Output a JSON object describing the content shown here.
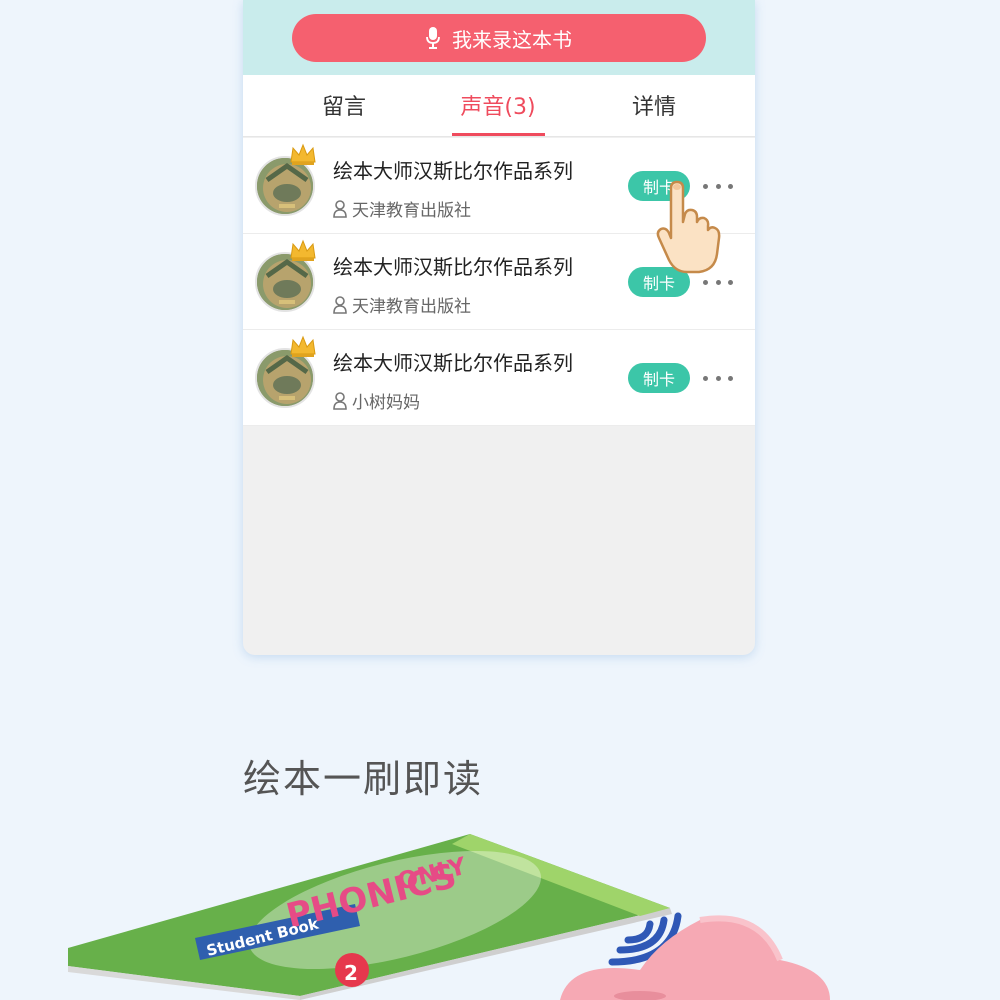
{
  "record_button": {
    "label": "我来录这本书"
  },
  "tabs": [
    {
      "label": "留言",
      "active": false
    },
    {
      "label": "声音(3)",
      "active": true
    },
    {
      "label": "详情",
      "active": false
    }
  ],
  "items": [
    {
      "title": "绘本大师汉斯比尔作品系列",
      "author": "天津教育出版社",
      "action": "制卡"
    },
    {
      "title": "绘本大师汉斯比尔作品系列",
      "author": "天津教育出版社",
      "action": "制卡"
    },
    {
      "title": "绘本大师汉斯比尔作品系列",
      "author": "小树妈妈",
      "action": "制卡"
    }
  ],
  "section": {
    "title": "绘本一刷即读"
  },
  "book": {
    "cover_text_1": "ONLY",
    "cover_text_2": "PHONICS",
    "cover_text_3": "Student Book",
    "volume": "2"
  },
  "colors": {
    "accent": "#f5606f",
    "tab_active": "#ef4b5d",
    "card_button": "#3cc6a8"
  },
  "icons": [
    "mic-icon",
    "crown-icon",
    "person-icon",
    "more-icon",
    "tap-hand-icon",
    "nfc-signal-icon"
  ]
}
